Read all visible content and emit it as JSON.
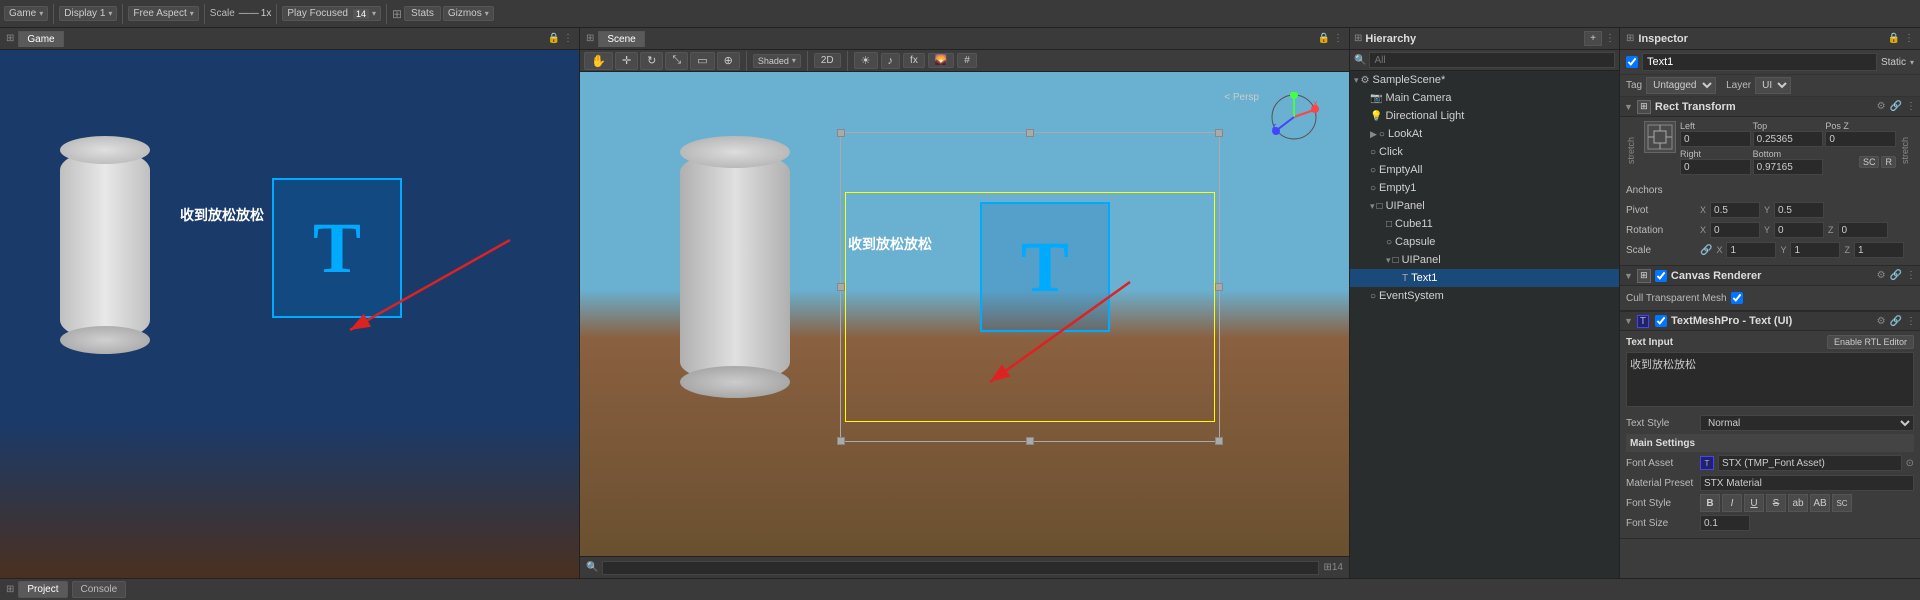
{
  "toolbar": {
    "game_label": "Game",
    "display_label": "Display 1",
    "aspect_label": "Free Aspect",
    "scale_label": "Scale",
    "scale_value": "1x",
    "play_focused_label": "Play Focused",
    "stats_label": "Stats",
    "gizmos_label": "Gizmos",
    "chevron": "▾"
  },
  "scene_toolbar": {
    "scene_label": "Scene",
    "mode_2d": "2D",
    "persp_label": "< Persp"
  },
  "hierarchy": {
    "title": "Hierarchy",
    "search_placeholder": "All",
    "items": [
      {
        "id": "sample-scene",
        "label": "SampleScene*",
        "indent": 0,
        "arrow": "▾",
        "icon": "⚙",
        "expanded": true
      },
      {
        "id": "main-camera",
        "label": "Main Camera",
        "indent": 1,
        "arrow": "",
        "icon": "📷"
      },
      {
        "id": "directional-light",
        "label": "Directional Light",
        "indent": 1,
        "arrow": "",
        "icon": "💡"
      },
      {
        "id": "look-at",
        "label": "LookAt",
        "indent": 1,
        "arrow": "",
        "icon": "○"
      },
      {
        "id": "click",
        "label": "Click",
        "indent": 1,
        "arrow": "",
        "icon": "○"
      },
      {
        "id": "empty-all",
        "label": "EmptyAll",
        "indent": 1,
        "arrow": "",
        "icon": "○"
      },
      {
        "id": "empty1",
        "label": "Empty1",
        "indent": 1,
        "arrow": "",
        "icon": "○"
      },
      {
        "id": "ui-panel-root",
        "label": "UIPanel",
        "indent": 1,
        "arrow": "▾",
        "icon": "□",
        "expanded": true
      },
      {
        "id": "cube11",
        "label": "Cube11",
        "indent": 2,
        "arrow": "",
        "icon": "□"
      },
      {
        "id": "capsule",
        "label": "Capsule",
        "indent": 2,
        "arrow": "",
        "icon": "○"
      },
      {
        "id": "ui-panel",
        "label": "UIPanel",
        "indent": 2,
        "arrow": "▾",
        "icon": "□",
        "expanded": true
      },
      {
        "id": "text1",
        "label": "Text1",
        "indent": 3,
        "arrow": "",
        "icon": "T",
        "selected": true
      },
      {
        "id": "event-system",
        "label": "EventSystem",
        "indent": 1,
        "arrow": "",
        "icon": "○"
      }
    ]
  },
  "inspector": {
    "title": "Inspector",
    "object_name": "Text1",
    "static_label": "Static",
    "tag_label": "Tag",
    "tag_value": "Untagged",
    "layer_label": "Layer",
    "layer_value": "UI",
    "rect_transform_title": "Rect Transform",
    "stretch_label": "stretch",
    "left_label": "Left",
    "left_value": "0",
    "top_label": "Top",
    "top_value": "0.25365",
    "posz_label": "Pos Z",
    "posz_value": "0",
    "right_label": "Right",
    "right_value": "0",
    "bottom_label": "Bottom",
    "bottom_value": "0.97165",
    "sc_label": "SC",
    "r_label": "R",
    "anchors_label": "Anchors",
    "pivot_label": "Pivot",
    "pivot_x": "0.5",
    "pivot_y": "0.5",
    "rotation_label": "Rotation",
    "rot_x": "0",
    "rot_y": "0",
    "rot_z": "0",
    "scale_label": "Scale",
    "scale_x": "1",
    "scale_y": "1",
    "scale_z": "1",
    "canvas_renderer_title": "Canvas Renderer",
    "cull_mesh_label": "Cull Transparent Mesh",
    "tmp_title": "TextMeshPro - Text (UI)",
    "text_input_label": "Text Input",
    "rtl_editor_label": "Enable RTL Editor",
    "text_input_value": "收到放松放松",
    "text_style_label": "Text Style",
    "text_style_value": "Normal",
    "main_settings_label": "Main Settings",
    "font_asset_label": "Font Asset",
    "font_asset_value": "STX (TMP_Font Asset)",
    "material_preset_label": "Material Preset",
    "material_preset_value": "STX Material",
    "font_style_label": "Font Style",
    "font_style_btns": [
      "B",
      "I",
      "U",
      "S",
      "ab",
      "AB",
      "SC"
    ],
    "font_size_label": "Font Size",
    "font_size_value": "0.1"
  },
  "game_panel": {
    "title": "Game",
    "text_label": "收到放松放松",
    "t_letter": "T"
  },
  "scene_panel": {
    "title": "Scene",
    "text_label": "收到放松放松",
    "t_letter": "T",
    "persp": "< Persp"
  },
  "bottom": {
    "project_label": "Project",
    "console_label": "Console"
  }
}
